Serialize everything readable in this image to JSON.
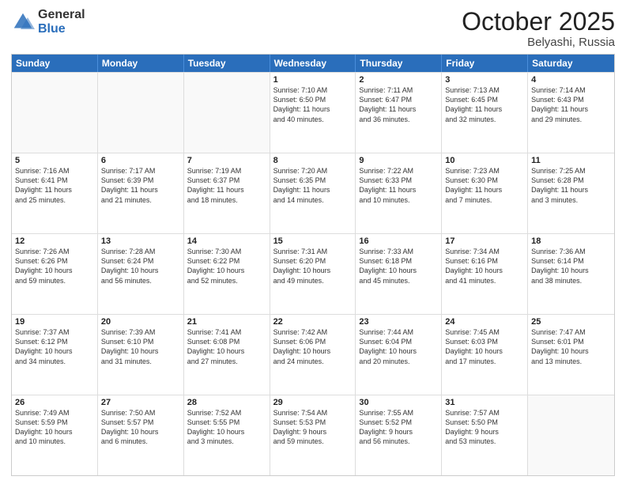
{
  "logo": {
    "general": "General",
    "blue": "Blue"
  },
  "title": {
    "month": "October 2025",
    "location": "Belyashi, Russia"
  },
  "days": [
    "Sunday",
    "Monday",
    "Tuesday",
    "Wednesday",
    "Thursday",
    "Friday",
    "Saturday"
  ],
  "weeks": [
    [
      {
        "date": "",
        "info": "",
        "empty": true
      },
      {
        "date": "",
        "info": "",
        "empty": true
      },
      {
        "date": "",
        "info": "",
        "empty": true
      },
      {
        "date": "1",
        "info": "Sunrise: 7:10 AM\nSunset: 6:50 PM\nDaylight: 11 hours\nand 40 minutes.",
        "empty": false
      },
      {
        "date": "2",
        "info": "Sunrise: 7:11 AM\nSunset: 6:47 PM\nDaylight: 11 hours\nand 36 minutes.",
        "empty": false
      },
      {
        "date": "3",
        "info": "Sunrise: 7:13 AM\nSunset: 6:45 PM\nDaylight: 11 hours\nand 32 minutes.",
        "empty": false
      },
      {
        "date": "4",
        "info": "Sunrise: 7:14 AM\nSunset: 6:43 PM\nDaylight: 11 hours\nand 29 minutes.",
        "empty": false
      }
    ],
    [
      {
        "date": "5",
        "info": "Sunrise: 7:16 AM\nSunset: 6:41 PM\nDaylight: 11 hours\nand 25 minutes.",
        "empty": false
      },
      {
        "date": "6",
        "info": "Sunrise: 7:17 AM\nSunset: 6:39 PM\nDaylight: 11 hours\nand 21 minutes.",
        "empty": false
      },
      {
        "date": "7",
        "info": "Sunrise: 7:19 AM\nSunset: 6:37 PM\nDaylight: 11 hours\nand 18 minutes.",
        "empty": false
      },
      {
        "date": "8",
        "info": "Sunrise: 7:20 AM\nSunset: 6:35 PM\nDaylight: 11 hours\nand 14 minutes.",
        "empty": false
      },
      {
        "date": "9",
        "info": "Sunrise: 7:22 AM\nSunset: 6:33 PM\nDaylight: 11 hours\nand 10 minutes.",
        "empty": false
      },
      {
        "date": "10",
        "info": "Sunrise: 7:23 AM\nSunset: 6:30 PM\nDaylight: 11 hours\nand 7 minutes.",
        "empty": false
      },
      {
        "date": "11",
        "info": "Sunrise: 7:25 AM\nSunset: 6:28 PM\nDaylight: 11 hours\nand 3 minutes.",
        "empty": false
      }
    ],
    [
      {
        "date": "12",
        "info": "Sunrise: 7:26 AM\nSunset: 6:26 PM\nDaylight: 10 hours\nand 59 minutes.",
        "empty": false
      },
      {
        "date": "13",
        "info": "Sunrise: 7:28 AM\nSunset: 6:24 PM\nDaylight: 10 hours\nand 56 minutes.",
        "empty": false
      },
      {
        "date": "14",
        "info": "Sunrise: 7:30 AM\nSunset: 6:22 PM\nDaylight: 10 hours\nand 52 minutes.",
        "empty": false
      },
      {
        "date": "15",
        "info": "Sunrise: 7:31 AM\nSunset: 6:20 PM\nDaylight: 10 hours\nand 49 minutes.",
        "empty": false
      },
      {
        "date": "16",
        "info": "Sunrise: 7:33 AM\nSunset: 6:18 PM\nDaylight: 10 hours\nand 45 minutes.",
        "empty": false
      },
      {
        "date": "17",
        "info": "Sunrise: 7:34 AM\nSunset: 6:16 PM\nDaylight: 10 hours\nand 41 minutes.",
        "empty": false
      },
      {
        "date": "18",
        "info": "Sunrise: 7:36 AM\nSunset: 6:14 PM\nDaylight: 10 hours\nand 38 minutes.",
        "empty": false
      }
    ],
    [
      {
        "date": "19",
        "info": "Sunrise: 7:37 AM\nSunset: 6:12 PM\nDaylight: 10 hours\nand 34 minutes.",
        "empty": false
      },
      {
        "date": "20",
        "info": "Sunrise: 7:39 AM\nSunset: 6:10 PM\nDaylight: 10 hours\nand 31 minutes.",
        "empty": false
      },
      {
        "date": "21",
        "info": "Sunrise: 7:41 AM\nSunset: 6:08 PM\nDaylight: 10 hours\nand 27 minutes.",
        "empty": false
      },
      {
        "date": "22",
        "info": "Sunrise: 7:42 AM\nSunset: 6:06 PM\nDaylight: 10 hours\nand 24 minutes.",
        "empty": false
      },
      {
        "date": "23",
        "info": "Sunrise: 7:44 AM\nSunset: 6:04 PM\nDaylight: 10 hours\nand 20 minutes.",
        "empty": false
      },
      {
        "date": "24",
        "info": "Sunrise: 7:45 AM\nSunset: 6:03 PM\nDaylight: 10 hours\nand 17 minutes.",
        "empty": false
      },
      {
        "date": "25",
        "info": "Sunrise: 7:47 AM\nSunset: 6:01 PM\nDaylight: 10 hours\nand 13 minutes.",
        "empty": false
      }
    ],
    [
      {
        "date": "26",
        "info": "Sunrise: 7:49 AM\nSunset: 5:59 PM\nDaylight: 10 hours\nand 10 minutes.",
        "empty": false
      },
      {
        "date": "27",
        "info": "Sunrise: 7:50 AM\nSunset: 5:57 PM\nDaylight: 10 hours\nand 6 minutes.",
        "empty": false
      },
      {
        "date": "28",
        "info": "Sunrise: 7:52 AM\nSunset: 5:55 PM\nDaylight: 10 hours\nand 3 minutes.",
        "empty": false
      },
      {
        "date": "29",
        "info": "Sunrise: 7:54 AM\nSunset: 5:53 PM\nDaylight: 9 hours\nand 59 minutes.",
        "empty": false
      },
      {
        "date": "30",
        "info": "Sunrise: 7:55 AM\nSunset: 5:52 PM\nDaylight: 9 hours\nand 56 minutes.",
        "empty": false
      },
      {
        "date": "31",
        "info": "Sunrise: 7:57 AM\nSunset: 5:50 PM\nDaylight: 9 hours\nand 53 minutes.",
        "empty": false
      },
      {
        "date": "",
        "info": "",
        "empty": true
      }
    ]
  ]
}
